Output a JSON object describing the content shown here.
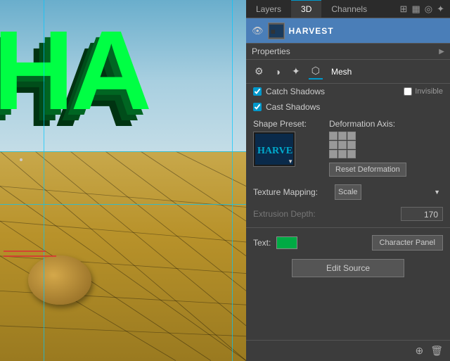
{
  "tabs": {
    "layers_label": "Layers",
    "3d_label": "3D",
    "channels_label": "Channels"
  },
  "tab_icons": {
    "icon1": "⊞",
    "icon2": "▦",
    "icon3": "◉",
    "icon4": "☀"
  },
  "layer": {
    "name": "HARVEST"
  },
  "properties": {
    "title": "Properties",
    "mesh_label": "Mesh"
  },
  "checkboxes": {
    "catch_shadows": "Catch Shadows",
    "cast_shadows": "Cast Shadows",
    "invisible": "Invisible"
  },
  "shape_preset": {
    "label": "Shape Preset:",
    "preview_text": "HARVEST"
  },
  "deformation": {
    "label": "Deformation Axis:",
    "reset_button": "Reset Deformation"
  },
  "texture_mapping": {
    "label": "Texture Mapping:",
    "value": "Scale"
  },
  "extrusion": {
    "label": "Extrusion Depth:",
    "value": "170"
  },
  "text_section": {
    "label": "Text:",
    "char_panel_button": "Character Panel",
    "edit_source_button": "Edit Source"
  },
  "bottom": {
    "icon1": "⊕",
    "icon2": "🗑"
  }
}
